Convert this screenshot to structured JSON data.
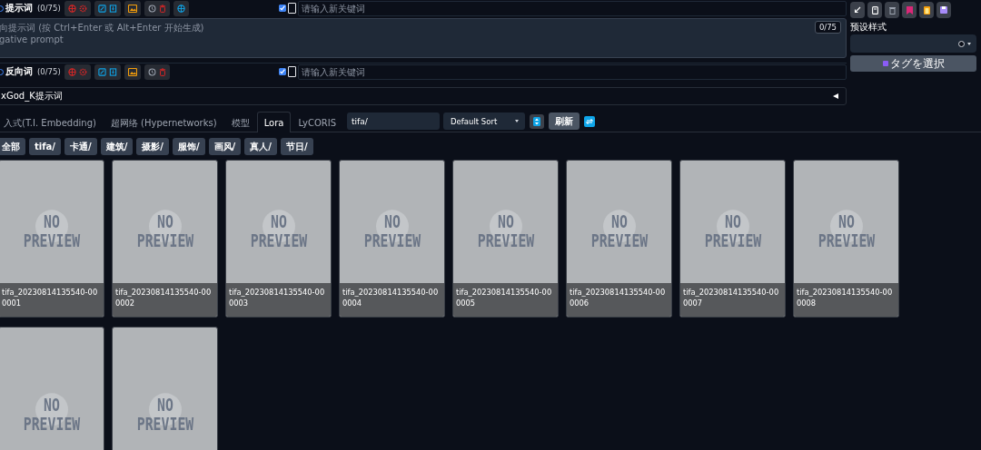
{
  "prompt_row": {
    "label": "提示词",
    "count": "(0/75)",
    "keyword_enabled": true,
    "keyword_placeholder": "请输入新关键词"
  },
  "negative_prompt": {
    "placeholder": "向提示词 (按 Ctrl+Enter 或 Alt+Enter 开始生成)\ngative prompt",
    "token_count": "0/75"
  },
  "negative_row": {
    "label": "反向词",
    "count": "(0/75)",
    "keyword_enabled": true,
    "keyword_placeholder": "请输入新关键词"
  },
  "extra_section": {
    "title": "xGod_K提示词",
    "expanded": false
  },
  "styles_panel": {
    "label": "预设样式",
    "tag_button": "タグを選択"
  },
  "tabs": [
    {
      "label": "入式(T.I. Embedding)",
      "selected": false
    },
    {
      "label": "超网络 (Hypernetworks)",
      "selected": false
    },
    {
      "label": "模型",
      "selected": false
    },
    {
      "label": "Lora",
      "selected": true
    },
    {
      "label": "LyCORIS",
      "selected": false
    }
  ],
  "search": {
    "value": "tifa/"
  },
  "sort": {
    "value": "Default Sort"
  },
  "refresh_button": "刷新",
  "filters": [
    {
      "label": "全部"
    },
    {
      "label": "tifa/"
    },
    {
      "label": "卡通/"
    },
    {
      "label": "建筑/"
    },
    {
      "label": "摄影/"
    },
    {
      "label": "服饰/"
    },
    {
      "label": "画风/"
    },
    {
      "label": "真人/"
    },
    {
      "label": "节日/"
    }
  ],
  "cards": [
    {
      "preview": "NO PREVIEW",
      "name": "tifa_20230814135540-000001"
    },
    {
      "preview": "NO PREVIEW",
      "name": "tifa_20230814135540-000002"
    },
    {
      "preview": "NO PREVIEW",
      "name": "tifa_20230814135540-000003"
    },
    {
      "preview": "NO PREVIEW",
      "name": "tifa_20230814135540-000004"
    },
    {
      "preview": "NO PREVIEW",
      "name": "tifa_20230814135540-000005"
    },
    {
      "preview": "NO PREVIEW",
      "name": "tifa_20230814135540-000006"
    },
    {
      "preview": "NO PREVIEW",
      "name": "tifa_20230814135540-000007"
    },
    {
      "preview": "NO PREVIEW",
      "name": "tifa_20230814135540-000008"
    },
    {
      "preview": "NO PREVIEW"
    },
    {
      "preview": "NO PREVIEW"
    }
  ]
}
